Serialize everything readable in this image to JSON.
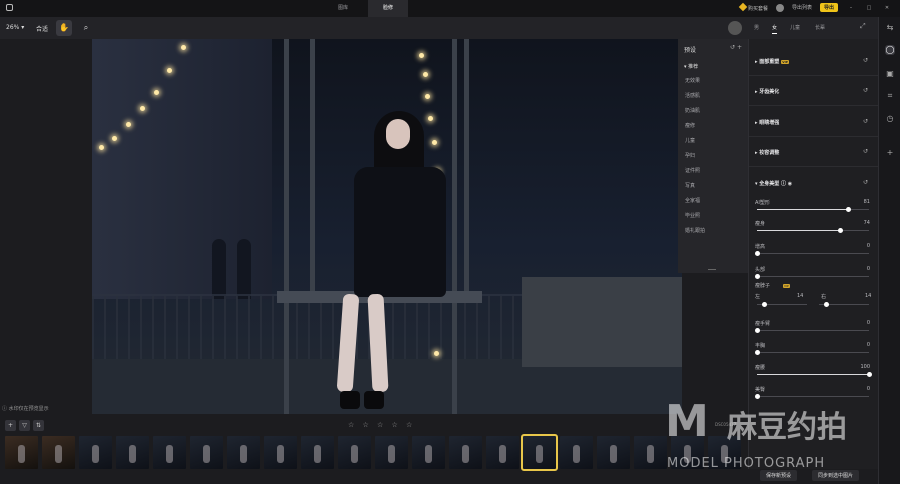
{
  "titlebar": {
    "tabs": [
      "图库",
      "脸修"
    ],
    "active_tab": "脸修",
    "vip_label": "购买套餐",
    "export_list_label": "导出列表",
    "export_label": "导出"
  },
  "toolbar": {
    "zoom": "26%",
    "fit_label": "合适"
  },
  "presets": {
    "title": "预设",
    "group": "推荐",
    "items": [
      "无效果",
      "活感肌",
      "奶油肌",
      "瘦修",
      "儿童",
      "孕妇",
      "证件照",
      "写真",
      "全家福",
      "毕业照",
      "婚礼跟拍"
    ]
  },
  "canvas": {
    "watermark_note": "水印仅在预览显示"
  },
  "filmstrip": {
    "rating": "☆ ☆ ☆ ☆ ☆",
    "doc_label": "DSC05417",
    "tool_icons": [
      "+",
      "▽",
      "⇅"
    ],
    "thumbnails": [
      "warm",
      "warm",
      "cool",
      "cool",
      "cool",
      "cool",
      "cool",
      "cool",
      "cool",
      "cool",
      "cool",
      "cool",
      "cool",
      "cool",
      "selected",
      "cool",
      "cool",
      "cool",
      "cool",
      "cool"
    ]
  },
  "right_panel": {
    "tabs": [
      "男",
      "女",
      "儿童",
      "长辈"
    ],
    "active_tab": "女",
    "sections": [
      {
        "label": "面部重塑",
        "vip": true
      },
      {
        "label": "牙齿美化",
        "vip": false
      },
      {
        "label": "眼睛增强",
        "vip": false
      },
      {
        "label": "妆容调整",
        "vip": false
      },
      {
        "label": "全身美型",
        "vip": false
      }
    ],
    "vip_badge": "VIP",
    "sliders": [
      {
        "label": "AI塑形",
        "value": "81",
        "pct": 0.81
      },
      {
        "label": "瘦身",
        "value": "74",
        "pct": 0.74
      },
      {
        "label": "增高",
        "value": "0",
        "pct": 0
      },
      {
        "label": "头部",
        "value": "0",
        "pct": 0
      },
      {
        "label": "瘦手臂",
        "value": "0",
        "pct": 0
      },
      {
        "label": "丰胸",
        "value": "0",
        "pct": 0
      },
      {
        "label": "瘦腰",
        "value": "100",
        "pct": 1.0
      },
      {
        "label": "美臀",
        "value": "0",
        "pct": 0
      }
    ],
    "neck": {
      "label": "瘦脖子",
      "left_label": "左",
      "left_value": "14",
      "right_label": "右",
      "right_value": "14"
    },
    "buttons": {
      "save_preset": "保存新预设",
      "sync": "同步到选中图片"
    }
  },
  "brand": {
    "logo": "M",
    "cn": "麻豆约拍",
    "en": "MODEL PHOTOGRAPH"
  }
}
